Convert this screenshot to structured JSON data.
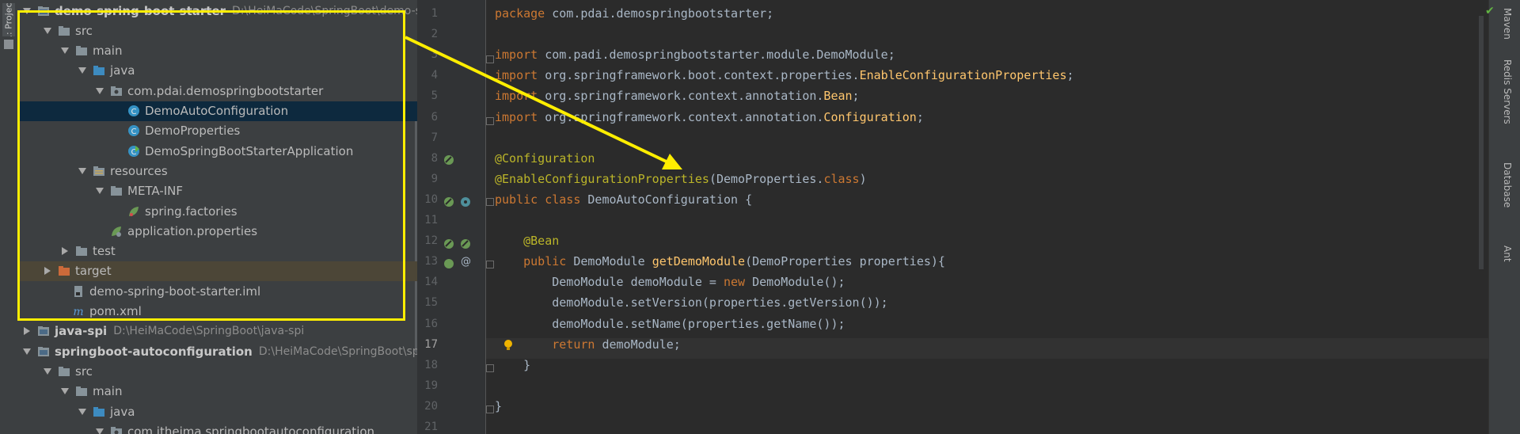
{
  "left_strip": {
    "project_tab_label": "1: Project"
  },
  "tree": {
    "items": [
      {
        "label": "demo-spring-boot-starter",
        "path": "D:\\HeiMaCode\\SpringBoot\\demo-spring-boot-starter",
        "kind": "module"
      },
      {
        "label": "src",
        "kind": "folder"
      },
      {
        "label": "main",
        "kind": "folder"
      },
      {
        "label": "java",
        "kind": "source-folder"
      },
      {
        "label": "com.pdai.demospringbootstarter",
        "kind": "package"
      },
      {
        "label": "DemoAutoConfiguration",
        "kind": "class"
      },
      {
        "label": "DemoProperties",
        "kind": "class"
      },
      {
        "label": "DemoSpringBootStarterApplication",
        "kind": "class-app"
      },
      {
        "label": "resources",
        "kind": "resources-folder"
      },
      {
        "label": "META-INF",
        "kind": "folder"
      },
      {
        "label": "spring.factories",
        "kind": "spring-file"
      },
      {
        "label": "application.properties",
        "kind": "spring-props"
      },
      {
        "label": "test",
        "kind": "folder"
      },
      {
        "label": "target",
        "kind": "target-folder"
      },
      {
        "label": "demo-spring-boot-starter.iml",
        "kind": "iml"
      },
      {
        "label": "pom.xml",
        "kind": "maven"
      },
      {
        "label": "java-spi",
        "path": "D:\\HeiMaCode\\SpringBoot\\java-spi",
        "kind": "module"
      },
      {
        "label": "springboot-autoconfiguration",
        "path": "D:\\HeiMaCode\\SpringBoot\\springboot-autoconfiguration",
        "kind": "module"
      },
      {
        "label": "src",
        "kind": "folder"
      },
      {
        "label": "main",
        "kind": "folder"
      },
      {
        "label": "java",
        "kind": "source-folder"
      },
      {
        "label": "com.itheima.springbootautoconfiguration",
        "kind": "package"
      }
    ]
  },
  "editor": {
    "current_line": 17,
    "lines": [
      {
        "n": "1",
        "tokens": [
          [
            "kw",
            "package "
          ],
          [
            "pl",
            "com.pdai.demospringbootstarter;"
          ]
        ]
      },
      {
        "n": "2",
        "tokens": []
      },
      {
        "n": "3",
        "tokens": [
          [
            "kw",
            "import "
          ],
          [
            "pl",
            "com.padi.demospringbootstarter.module.DemoModule;"
          ]
        ]
      },
      {
        "n": "4",
        "tokens": [
          [
            "kw",
            "import "
          ],
          [
            "pl",
            "org.springframework.boot.context.properties."
          ],
          [
            "ty",
            "EnableConfigurationProperties"
          ],
          [
            "pl",
            ";"
          ]
        ]
      },
      {
        "n": "5",
        "tokens": [
          [
            "kw",
            "import "
          ],
          [
            "pl",
            "org.springframework.context.annotation."
          ],
          [
            "ty",
            "Bean"
          ],
          [
            "pl",
            ";"
          ]
        ]
      },
      {
        "n": "6",
        "tokens": [
          [
            "kw",
            "import "
          ],
          [
            "pl",
            "org.springframework.context.annotation."
          ],
          [
            "ty",
            "Configuration"
          ],
          [
            "pl",
            ";"
          ]
        ]
      },
      {
        "n": "7",
        "tokens": []
      },
      {
        "n": "8",
        "tokens": [
          [
            "ann",
            "@Configuration"
          ]
        ]
      },
      {
        "n": "9",
        "tokens": [
          [
            "ann",
            "@EnableConfigurationProperties"
          ],
          [
            "pl",
            "(DemoProperties."
          ],
          [
            "kw",
            "class"
          ],
          [
            "pl",
            ")"
          ]
        ]
      },
      {
        "n": "10",
        "tokens": [
          [
            "kw",
            "public class "
          ],
          [
            "pl",
            "DemoAutoConfiguration {"
          ]
        ]
      },
      {
        "n": "11",
        "tokens": []
      },
      {
        "n": "12",
        "tokens": [
          [
            "pl",
            "    "
          ],
          [
            "ann",
            "@Bean"
          ]
        ]
      },
      {
        "n": "13",
        "tokens": [
          [
            "pl",
            "    "
          ],
          [
            "kw",
            "public "
          ],
          [
            "pl",
            "DemoModule "
          ],
          [
            "ty",
            "getDemoModule"
          ],
          [
            "pl",
            "(DemoProperties properties){"
          ]
        ]
      },
      {
        "n": "14",
        "tokens": [
          [
            "pl",
            "        DemoModule demoModule = "
          ],
          [
            "kw",
            "new "
          ],
          [
            "pl",
            "DemoModule();"
          ]
        ]
      },
      {
        "n": "15",
        "tokens": [
          [
            "pl",
            "        demoModule.setVersion(properties.getVersion());"
          ]
        ]
      },
      {
        "n": "16",
        "tokens": [
          [
            "pl",
            "        demoModule.setName(properties.getName());"
          ]
        ]
      },
      {
        "n": "17",
        "tokens": [
          [
            "pl",
            "        "
          ],
          [
            "kw",
            "return "
          ],
          [
            "pl",
            "demoModule;"
          ]
        ]
      },
      {
        "n": "18",
        "tokens": [
          [
            "pl",
            "    }"
          ]
        ]
      },
      {
        "n": "19",
        "tokens": []
      },
      {
        "n": "20",
        "tokens": [
          [
            "pl",
            "}"
          ]
        ]
      },
      {
        "n": "21",
        "tokens": []
      }
    ]
  },
  "right_strip": {
    "tabs": [
      "Maven",
      "Redis Servers",
      "Database",
      "Ant"
    ]
  },
  "colors": {
    "highlight": "#ffee00",
    "keyword": "#cc7832",
    "annotation": "#bbb529",
    "method": "#ffc66d",
    "text": "#a9b7c6"
  }
}
